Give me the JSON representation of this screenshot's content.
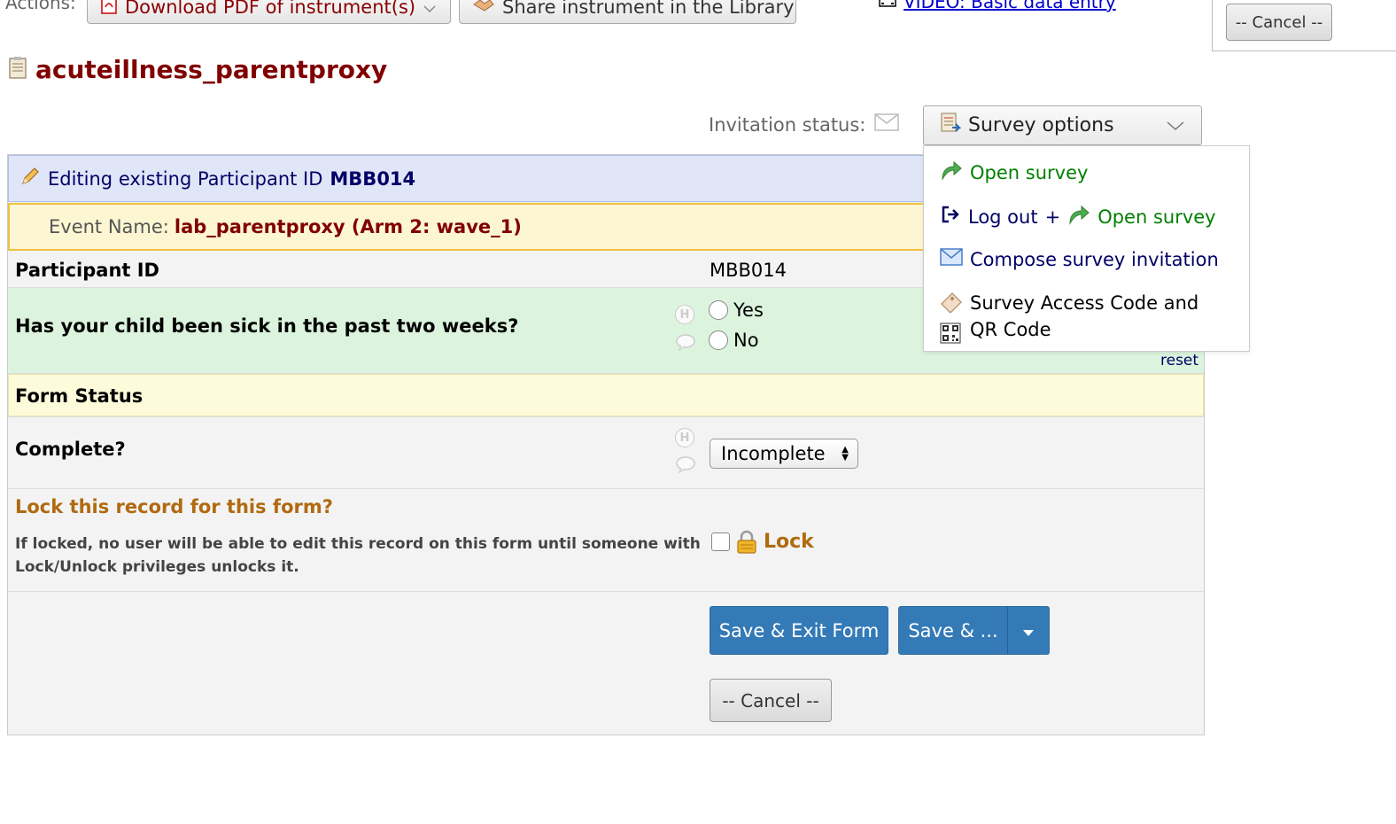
{
  "actions": {
    "label": "Actions:",
    "download_pdf": "Download PDF of instrument(s)",
    "share": "Share instrument in the Library",
    "video": "VIDEO: Basic data entry",
    "cancel_top": "-- Cancel --"
  },
  "instrument": {
    "title": "acuteillness_parentproxy"
  },
  "invitation": {
    "label": "Invitation status:"
  },
  "survey_options": {
    "label": "Survey options",
    "menu": {
      "open_survey": "Open survey",
      "logout": "Log out",
      "plus": "+",
      "logout_open_survey": "Open survey",
      "compose": "Compose survey invitation",
      "access_code_line1": "Survey Access Code and",
      "access_code_line2": "QR Code"
    }
  },
  "form": {
    "editing_prefix": "Editing existing Participant ID",
    "editing_id": "MBB014",
    "event_label": "Event Name:",
    "event_value": "lab_parentproxy (Arm 2: wave_1)",
    "pid_label": "Participant ID",
    "pid_value": "MBB014",
    "sick_question": "Has your child been sick in the past two weeks?",
    "sick_options": [
      "Yes",
      "No"
    ],
    "reset": "reset",
    "form_status_header": "Form Status",
    "complete_label": "Complete?",
    "complete_value": "Incomplete",
    "lock_title": "Lock this record for this form?",
    "lock_desc_line1": "If locked, no user will be able to edit this record on this form until someone with",
    "lock_desc_line2": "Lock/Unlock privileges unlocks it.",
    "lock_label": "Lock",
    "save_exit": "Save & Exit Form",
    "save_more": "Save & ...",
    "cancel": "-- Cancel --"
  },
  "colors": {
    "title": "#800000",
    "primary_button": "#337ab7",
    "lock_text": "#b8860b",
    "link_green": "#008000",
    "navy": "#000066"
  }
}
